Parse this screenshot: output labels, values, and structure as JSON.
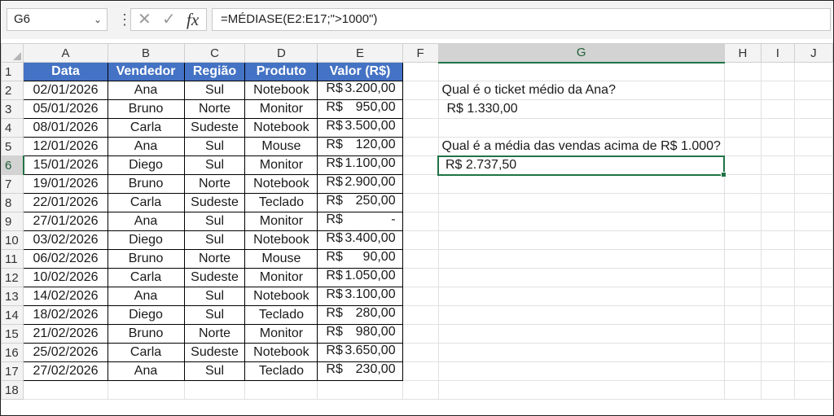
{
  "formula_bar": {
    "name_box": "G6",
    "formula": "=MÉDIASE(E2:E17;\">1000\")"
  },
  "columns": [
    "A",
    "B",
    "C",
    "D",
    "E",
    "F",
    "G",
    "H",
    "I",
    "J"
  ],
  "rows": [
    "1",
    "2",
    "3",
    "4",
    "5",
    "6",
    "7",
    "8",
    "9",
    "10",
    "11",
    "12",
    "13",
    "14",
    "15",
    "16",
    "17",
    "18"
  ],
  "table": {
    "headers": [
      "Data",
      "Vendedor",
      "Região",
      "Produto",
      "Valor (R$)"
    ],
    "currency": "R$",
    "data": [
      [
        "02/01/2026",
        "Ana",
        "Sul",
        "Notebook",
        "3.200,00"
      ],
      [
        "05/01/2026",
        "Bruno",
        "Norte",
        "Monitor",
        "950,00"
      ],
      [
        "08/01/2026",
        "Carla",
        "Sudeste",
        "Notebook",
        "3.500,00"
      ],
      [
        "12/01/2026",
        "Ana",
        "Sul",
        "Mouse",
        "120,00"
      ],
      [
        "15/01/2026",
        "Diego",
        "Sul",
        "Monitor",
        "1.100,00"
      ],
      [
        "19/01/2026",
        "Bruno",
        "Norte",
        "Notebook",
        "2.900,00"
      ],
      [
        "22/01/2026",
        "Carla",
        "Sudeste",
        "Teclado",
        "250,00"
      ],
      [
        "27/01/2026",
        "Ana",
        "Sul",
        "Monitor",
        "-"
      ],
      [
        "03/02/2026",
        "Diego",
        "Sul",
        "Notebook",
        "3.400,00"
      ],
      [
        "06/02/2026",
        "Bruno",
        "Norte",
        "Mouse",
        "90,00"
      ],
      [
        "10/02/2026",
        "Carla",
        "Sudeste",
        "Monitor",
        "1.050,00"
      ],
      [
        "14/02/2026",
        "Ana",
        "Sul",
        "Notebook",
        "3.100,00"
      ],
      [
        "18/02/2026",
        "Diego",
        "Sul",
        "Teclado",
        "280,00"
      ],
      [
        "21/02/2026",
        "Bruno",
        "Norte",
        "Monitor",
        "980,00"
      ],
      [
        "25/02/2026",
        "Carla",
        "Sudeste",
        "Notebook",
        "3.650,00"
      ],
      [
        "27/02/2026",
        "Ana",
        "Sul",
        "Teclado",
        "230,00"
      ]
    ]
  },
  "side": {
    "q1": "Qual é o ticket médio da Ana?",
    "a1": "R$ 1.330,00",
    "q2": "Qual é a média das vendas acima de R$ 1.000?",
    "a2": "R$ 2.737,50"
  },
  "selected_cell": {
    "column": "G",
    "row": "6"
  },
  "colors": {
    "header_fill": "#4472c4",
    "selection": "#217346"
  },
  "icons": [
    "chevron-down-icon",
    "more-options-icon",
    "cancel-icon",
    "enter-icon",
    "insert-function-icon"
  ]
}
